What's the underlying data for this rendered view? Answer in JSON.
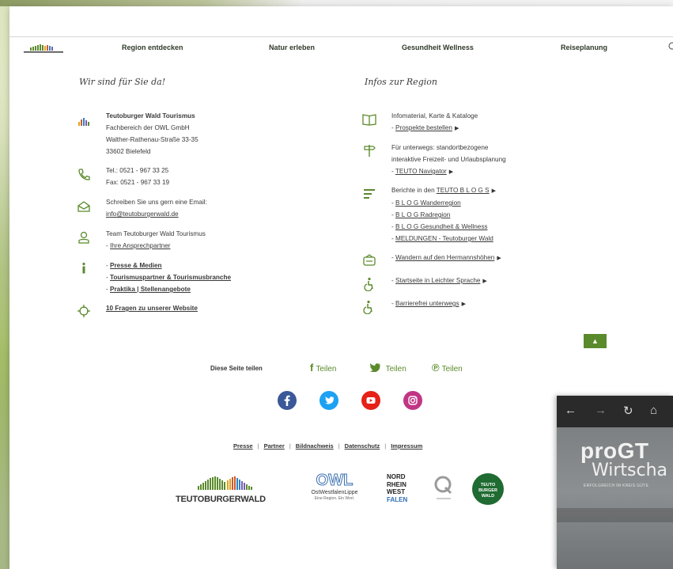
{
  "nav": {
    "items": [
      "Region entdecken",
      "Natur erleben",
      "Gesundheit Wellness",
      "Reiseplanung"
    ],
    "logo_text": "TEUTOBURGERWALD"
  },
  "contact": {
    "heading": "Wir sind für Sie da!",
    "org_name": "Teutoburger Wald Tourismus",
    "org_line2": "Fachbereich der OWL GmbH",
    "org_line3": "Walther-Rathenau-Straße 33-35",
    "org_line4": "33602 Bielefeld",
    "tel": "Tel.: 0521 - 967 33 25",
    "fax": "Fax: 0521 - 967 33 19",
    "email_intro": "Schreiben Sie uns gern eine Email:",
    "email": "info@teutoburgerwald.de",
    "team": "Team Teutoburger Wald Tourismus",
    "team_link": "Ihre Ansprechpartner",
    "press": "Presse & Medien",
    "partner": "Tourismuspartner & Tourismusbranche",
    "praktika": "Praktika | Stellenangebote",
    "faq": "10 Fragen zu unserer Website"
  },
  "infos": {
    "heading": "Infos zur Region",
    "info_text": "Infomaterial, Karte & Kataloge",
    "info_link": "Prospekte bestellen",
    "unterwegs_1": "Für unterwegs: standortbezogene",
    "unterwegs_2": "interaktive Freizeit- und Urlaubsplanung",
    "unterwegs_link": "TEUTO Navigator",
    "blogs_intro": "Berichte in den",
    "blogs_link": "TEUTO B L O G S",
    "blog1": "B L O G Wanderregion",
    "blog2": "B L O G Radregion",
    "blog3": "B L O G Gesundheit & Wellness",
    "blog4": "MELDUNGEN - Teutoburger Wald",
    "wandern": "Wandern auf den Hermannshöhen",
    "leichte": "Startseite in Leichter Sprache",
    "barriere": "Barrierefrei unterwegs"
  },
  "totop_icon": "arrow-up-icon",
  "share": {
    "label": "Diese Seite teilen",
    "facebook": "Teilen",
    "twitter": "Teilen",
    "pinterest": "Teilen"
  },
  "footer": {
    "links": [
      "Presse",
      "Partner",
      "Bildnachweis",
      "Datenschutz",
      "Impressum"
    ],
    "partner_teuto": "TEUTOBURGERWALD",
    "partner_owl_1": "OWL",
    "partner_owl_2": "OstWestfalenLippe",
    "partner_owl_3": "Eine Region. Ein Wort.",
    "partner_nrw": [
      "NORD",
      "RHEIN",
      "WEST",
      "FALEN"
    ],
    "partner_badge": [
      "TEUTO",
      "BURGER",
      "WALD"
    ]
  },
  "colors": {
    "accent_green": "#5a8a2b",
    "facebook": "#3b5998",
    "twitter": "#1da1f2",
    "youtube": "#e62117",
    "instagram": "#c13584"
  },
  "window2": {
    "title_1": "proGT",
    "title_2": "Wirtscha",
    "tagline": "ERFOLGREICH IM KREIS GÜTE"
  }
}
